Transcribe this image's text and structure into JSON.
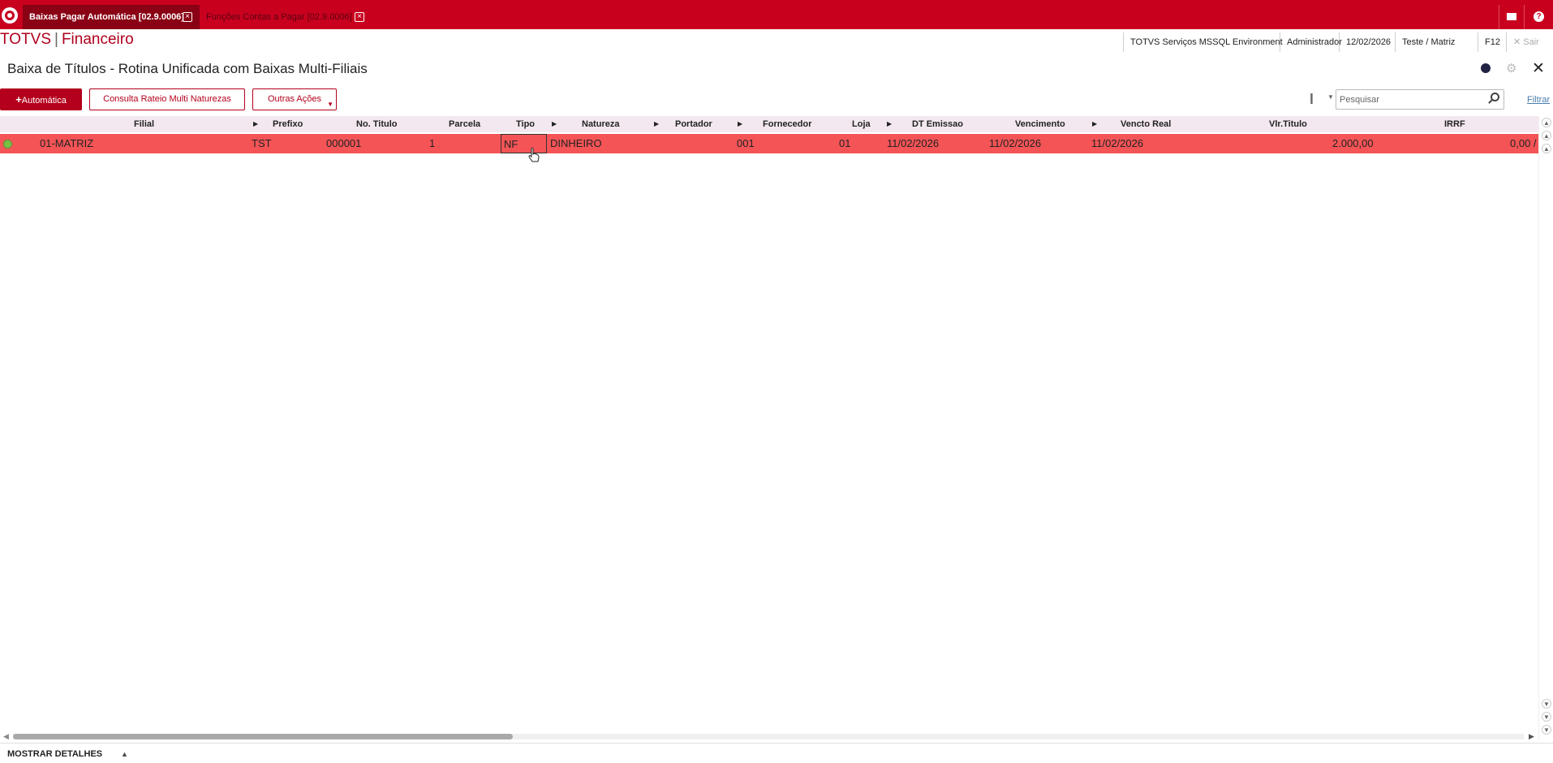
{
  "tabs": [
    {
      "label": "Baixas Pagar Automática [02.9.0006]",
      "active": true
    },
    {
      "label": "Funções Contas a Pagar [02.9.0006]",
      "active": false
    }
  ],
  "brand": {
    "name": "TOTVS",
    "separator": "|",
    "module": "Financeiro"
  },
  "status_bar": {
    "environment": "TOTVS Serviços MSSQL Environment",
    "user": "Administrador",
    "date": "12/02/2026",
    "branch": "Teste / Matriz",
    "shortcut": "F12",
    "exit_label": "Sair"
  },
  "page": {
    "title": "Baixa de Títulos - Rotina Unificada com Baixas Multi-Filiais"
  },
  "toolbar": {
    "auto_label": "Automática",
    "rateio_label": "Consulta Rateio Multi Naturezas",
    "outras_label": "Outras Ações"
  },
  "search": {
    "placeholder": "Pesquisar"
  },
  "filter_label": "Filtrar",
  "grid": {
    "columns": [
      "Filial",
      "Prefixo",
      "No. Titulo",
      "Parcela",
      "Tipo",
      "Natureza",
      "Portador",
      "Fornecedor",
      "Loja",
      "DT Emissao",
      "Vencimento",
      "Vencto Real",
      "Vlr.Titulo",
      "IRRF"
    ],
    "rows": [
      {
        "status": "green",
        "filial": "01-MATRIZ",
        "prefixo": "TST",
        "no_titulo": "000001",
        "parcela": "1",
        "tipo": "NF",
        "natureza": "DINHEIRO",
        "portador": "",
        "fornecedor": "001",
        "loja": "01",
        "dt_emissao": "11/02/2026",
        "vencimento": "11/02/2026",
        "vencto_real": "11/02/2026",
        "vlr_titulo": "2.000,00",
        "irrf": "0,00 /"
      }
    ]
  },
  "footer": {
    "details_label": "MOSTRAR DETALHES"
  },
  "colors": {
    "brand_red": "#c8001e",
    "row_highlight": "#f45456",
    "header_bg": "#f3e8ef",
    "status_ok": "#7ac043"
  }
}
